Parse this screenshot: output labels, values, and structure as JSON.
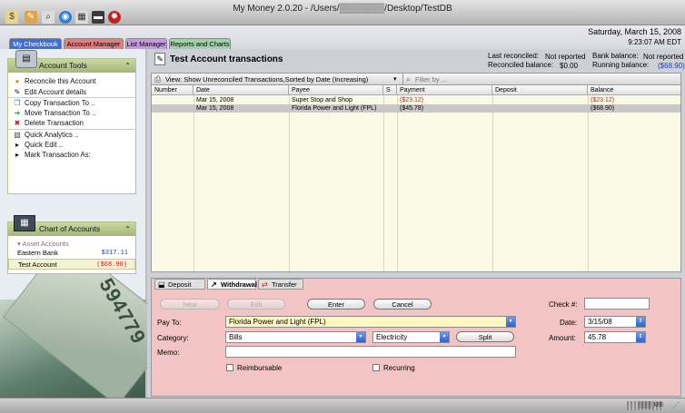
{
  "window": {
    "title": "My Money 2.0.20 - /Users/▒▒▒▒▒▒▒/Desktop/TestDB"
  },
  "date": {
    "day": "Saturday, March 15, 2008",
    "time": "9:23:07 AM EDT"
  },
  "tabs": [
    {
      "label": "My Checkbook",
      "color": "#3f6fd1"
    },
    {
      "label": "Account Manager",
      "color": "#e07f7f"
    },
    {
      "label": "List Manager",
      "color": "#c797e6"
    },
    {
      "label": "Reports and Charts",
      "color": "#9fd2a8"
    }
  ],
  "account_tools": {
    "title": "Account Tools",
    "items": [
      {
        "label": "Reconcile this Account",
        "icon": "reconcile-icon"
      },
      {
        "label": "Edit Account details",
        "icon": "edit-icon"
      },
      {
        "label": "Copy Transaction To ..",
        "icon": "copy-icon"
      },
      {
        "label": "Move Transaction To ..",
        "icon": "move-icon"
      },
      {
        "label": "Delete Transaction",
        "icon": "delete-icon"
      },
      {
        "label": "Quick Analytics ..",
        "icon": "analytics-icon"
      },
      {
        "label": "Quick Edit ..",
        "icon": "bullet-icon"
      },
      {
        "label": "Mark Transaction As:",
        "icon": "bullet-icon"
      }
    ]
  },
  "chart_of_accounts": {
    "title": "Chart of Accounts",
    "group": "Asset Accounts",
    "accounts": [
      {
        "name": "Eastern Bank",
        "balance": "$317.11"
      },
      {
        "name": "Test Account",
        "balance": "($68.90)"
      }
    ]
  },
  "photo": {
    "number_text": "594779"
  },
  "transactions_header": {
    "title": "Test Account transactions",
    "last_reconciled_label": "Last reconciled:",
    "last_reconciled_value": "Not reported",
    "reconciled_balance_label": "Reconciled balance:",
    "reconciled_balance_value": "$0.00",
    "bank_balance_label": "Bank balance:",
    "bank_balance_value": "Not reported",
    "running_balance_label": "Running balance:",
    "running_balance_value": "($68.90)"
  },
  "filter": {
    "view_label": "View: Show Unreconciled Transactions,Sorted by Date (Increasing)",
    "placeholder": "Filter by ..."
  },
  "table": {
    "columns": [
      "Number",
      "Date",
      "Payee",
      "S",
      "Payment",
      "Deposit",
      "Balance"
    ],
    "rows": [
      {
        "number": "",
        "date": "Mar 15, 2008",
        "payee": "Super Stop and Shop",
        "s": "",
        "payment": "($23.12)",
        "deposit": "",
        "balance": "($23.12)"
      },
      {
        "number": "",
        "date": "Mar 15, 2008",
        "payee": "Florida Power and Light (FPL)",
        "s": "",
        "payment": "($45.78)",
        "deposit": "",
        "balance": "($68.90)"
      }
    ]
  },
  "form_tabs": {
    "deposit": "Deposit",
    "withdrawal": "Withdrawal",
    "transfer": "Transfer"
  },
  "form": {
    "new": "New",
    "edit": "Edit",
    "enter": "Enter",
    "cancel": "Cancel",
    "check_label": "Check #:",
    "check_value": "",
    "payto_label": "Pay To:",
    "payto_value": "Florida Power and Light (FPL)",
    "date_label": "Date:",
    "date_value": "3/15/08",
    "category_label": "Category:",
    "category_value": "Bills",
    "subcategory_value": "Electricity",
    "split": "Split",
    "amount_label": "Amount:",
    "amount_value": "45.78",
    "memo_label": "Memo:",
    "memo_value": "",
    "reimbursable": "Reimbursable",
    "recurring": "Recurring"
  },
  "status": {
    "memory": "▒▒▒ MB"
  },
  "colors": {
    "negative": "#d01c1c",
    "link_blue": "#1a3fb5",
    "selected_row": "#c8c8c8",
    "form_bg": "#f2c4c4"
  }
}
